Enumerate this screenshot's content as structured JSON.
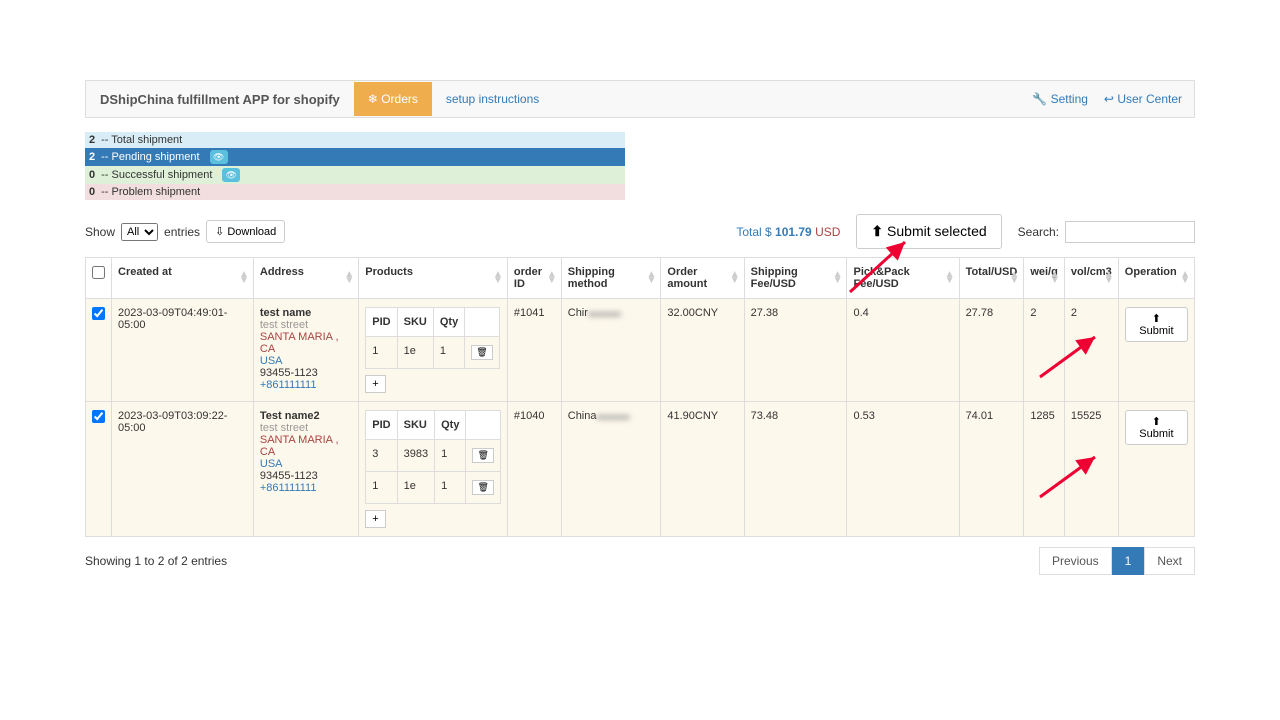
{
  "header": {
    "app_title": "DShipChina fulfillment APP for shopify",
    "tab_orders": "Orders",
    "tab_setup": "setup instructions",
    "link_setting": "Setting",
    "link_user_center": "User Center"
  },
  "summary": {
    "total": {
      "count": "2",
      "label": "-- Total shipment"
    },
    "pending": {
      "count": "2",
      "label": "-- Pending shipment"
    },
    "success": {
      "count": "0",
      "label": "-- Successful shipment"
    },
    "problem": {
      "count": "0",
      "label": "-- Problem shipment"
    }
  },
  "controls": {
    "show_label": "Show",
    "entries_label": "entries",
    "page_size": "All",
    "download": "Download",
    "total_label": "Total $",
    "total_amount": "101.79",
    "total_currency": "USD",
    "submit_selected": "Submit selected",
    "search_label": "Search:"
  },
  "columns": {
    "created_at": "Created at",
    "address": "Address",
    "products": "Products",
    "order_id": "order ID",
    "shipping_method": "Shipping method",
    "order_amount": "Order amount",
    "shipping_fee": "Shipping Fee/USD",
    "pickpack": "Pick&Pack Fee/USD",
    "total": "Total/USD",
    "wei": "wei/g",
    "vol": "vol/cm3",
    "operation": "Operation"
  },
  "prod_headers": {
    "pid": "PID",
    "sku": "SKU",
    "qty": "Qty"
  },
  "rows": [
    {
      "created_at": "2023-03-09T04:49:01-05:00",
      "address": {
        "name": "test name",
        "street": "test street",
        "loc": "SANTA MARIA , CA",
        "country": "USA",
        "zip": "93455-1123",
        "phone": "+861111111"
      },
      "products": [
        {
          "pid": "1",
          "sku": "1e",
          "qty": "1"
        }
      ],
      "order_id": "#1041",
      "shipping_method_pre": "Chir",
      "order_amount": "32.00CNY",
      "shipping_fee": "27.38",
      "pickpack": "0.4",
      "total": "27.78",
      "wei": "2",
      "vol": "2",
      "submit": "Submit"
    },
    {
      "created_at": "2023-03-09T03:09:22-05:00",
      "address": {
        "name": "Test name2",
        "street": "test street",
        "loc": "SANTA MARIA , CA",
        "country": "USA",
        "zip": "93455-1123",
        "phone": "+861111111"
      },
      "products": [
        {
          "pid": "3",
          "sku": "3983",
          "qty": "1"
        },
        {
          "pid": "1",
          "sku": "1e",
          "qty": "1"
        }
      ],
      "order_id": "#1040",
      "shipping_method_pre": "China",
      "order_amount": "41.90CNY",
      "shipping_fee": "73.48",
      "pickpack": "0.53",
      "total": "74.01",
      "wei": "1285",
      "vol": "15525",
      "submit": "Submit"
    }
  ],
  "footer": {
    "showing": "Showing 1 to 2 of 2 entries",
    "prev": "Previous",
    "page": "1",
    "next": "Next"
  }
}
